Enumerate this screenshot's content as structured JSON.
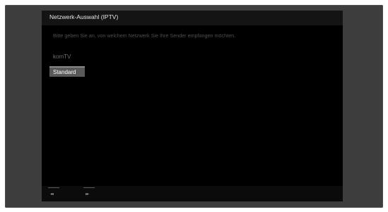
{
  "dialog": {
    "title": "Netzwerk-Auswahl (IPTV)",
    "instruction": "Bitte geben Sie an, von welchem Netzwerk Sie Ihre Sender empfangen möchten."
  },
  "options": [
    {
      "label": "komTV",
      "selected": false
    },
    {
      "label": "Standard",
      "selected": true
    }
  ],
  "footer": {
    "buttons": [
      {
        "icon": "rewind-icon",
        "glyph": "◂◂"
      },
      {
        "icon": "fast-forward-icon",
        "glyph": "▸▸"
      }
    ]
  },
  "colors": {
    "screen_bg": "#000000",
    "bezel": "#3d3d3d",
    "selected_bg": "#595959"
  }
}
